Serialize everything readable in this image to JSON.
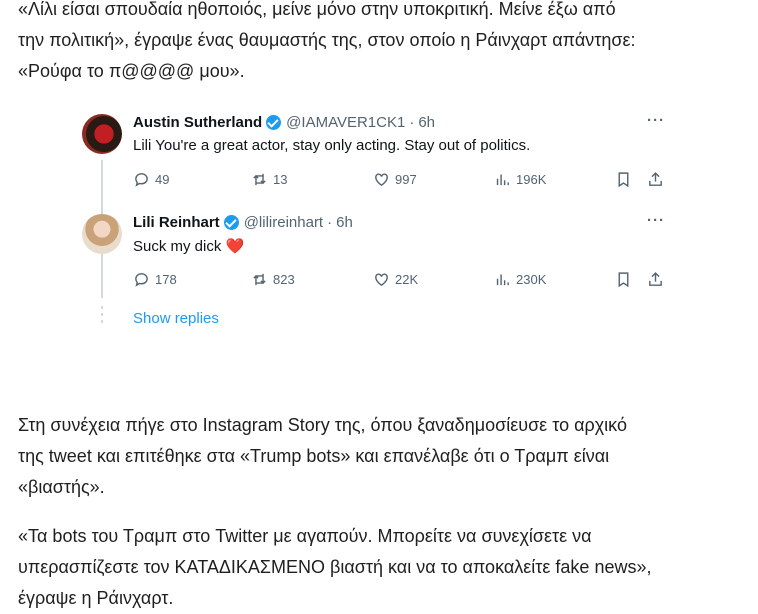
{
  "paragraphs": {
    "p1": [
      "«Λίλι είσαι σπουδαία ηθοποιός, μείνε μόνο στην υποκριτική. Μείνε έξω από",
      "την πολιτική», έγραψε ένας θαυμαστής της, στον οποίο η Ράινχαρτ απάντησε:",
      "«Ρούφα το π@@@@ μου»."
    ],
    "p2": [
      "Στη συνέχεια πήγε στο Instagram Story της, όπου ξαναδημοσίευσε το αρχικό",
      "της tweet και επιτέθηκε στα «Trump bots» και επανέλαβε ότι ο Τραμπ είναι",
      "«βιαστής»."
    ],
    "p3": [
      "«Τα bots του Τραμπ στο Twitter με αγαπούν. Μπορείτε να συνεχίσετε να",
      "υπερασπίζεστε τον ΚΑΤΑΔΙΚΑΣΜΕΝΟ βιαστή και να το αποκαλείτε fake news»,",
      "έγραψε η Ράινχαρτ."
    ]
  },
  "tweets": [
    {
      "name": "Austin Sutherland",
      "handle": "@IAMAVER1CK1",
      "time": "6h",
      "text": "Lili You're a great actor, stay only acting. Stay out of politics.",
      "replies": "49",
      "retweets": "13",
      "likes": "997",
      "views": "196K"
    },
    {
      "name": "Lili Reinhart",
      "handle": "@lilireinhart",
      "time": "6h",
      "text": "Suck my dick",
      "emoji": "❤️",
      "replies": "178",
      "retweets": "823",
      "likes": "22K",
      "views": "230K"
    }
  ],
  "show_replies": "Show replies",
  "separator": "·",
  "more": "···",
  "colors": {
    "accent": "#1d9bf0",
    "heart": "#e0245e",
    "muted": "#536471"
  },
  "icons": [
    "reply-icon",
    "retweet-icon",
    "like-icon",
    "views-icon",
    "bookmark-icon",
    "share-icon",
    "verified-icon",
    "more-icon"
  ]
}
